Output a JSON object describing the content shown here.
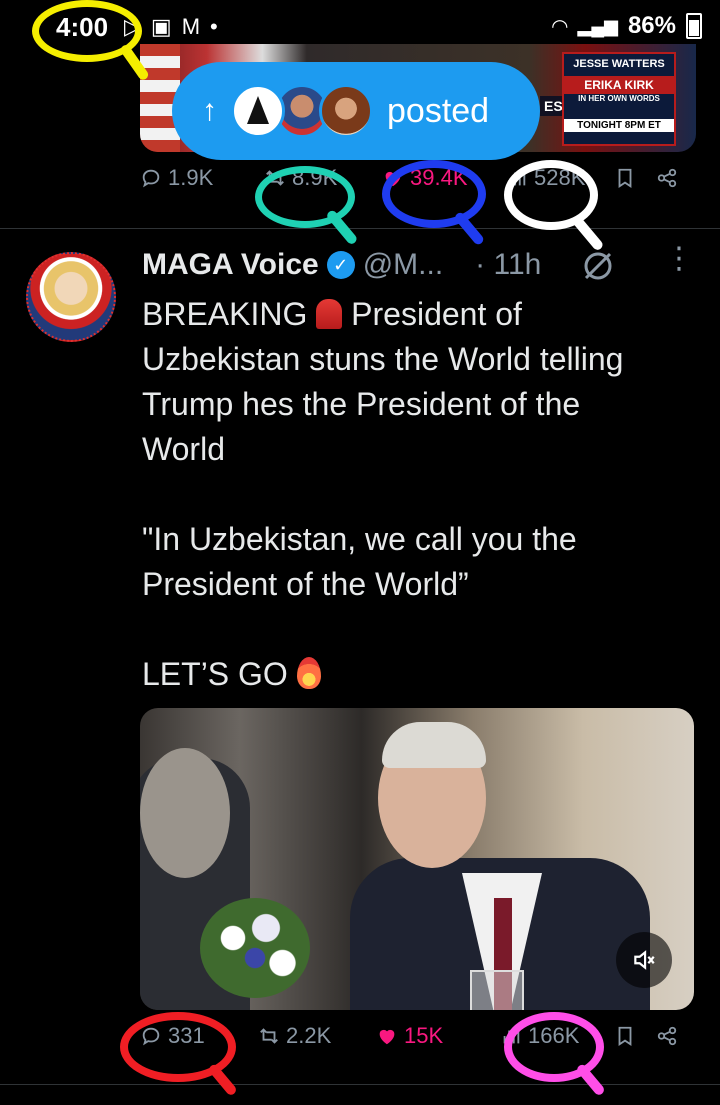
{
  "status_bar": {
    "time": "4:00",
    "battery": "86%",
    "icons": [
      "play-icon",
      "gallery-icon",
      "gmail-icon",
      "dot-icon",
      "wifi-icon",
      "signal-icon",
      "battery-icon"
    ]
  },
  "previous_post": {
    "media_overlay_name": "ERIKA KIRK",
    "media_overlay_show": "JESSE WATTERS",
    "media_overlay_time": "TONIGHT 8PM ET",
    "media_overlay_sub": "IN HER OWN WORDS",
    "media_partial_text": "ES",
    "stats": {
      "replies": "1.9K",
      "reposts": "8.9K",
      "likes": "39.4K",
      "views": "528K"
    }
  },
  "posted_pill": {
    "label": "posted"
  },
  "post": {
    "author_name": "MAGA Voice",
    "handle": "@M...",
    "time": "· 11h",
    "text_line1": "BREAKING",
    "text_line1_rest": " President of",
    "text_body": "Uzbekistan stuns the World telling\nTrump hes the President of the\nWorld\n\n\"In Uzbekistan, we call you the\nPresident of the World”\n\nLET’S GO",
    "stats": {
      "replies": "331",
      "reposts": "2.2K",
      "likes": "15K",
      "views": "166K"
    }
  },
  "colors": {
    "accent": "#1d9bf0",
    "like": "#f91880",
    "muted": "#8b98a5",
    "annotation_yellow": "#f5ee00",
    "annotation_teal": "#1fd1b3",
    "annotation_blue": "#1f3cf0",
    "annotation_white": "#ffffff",
    "annotation_red": "#f01e24",
    "annotation_magenta": "#ff4ee8"
  }
}
